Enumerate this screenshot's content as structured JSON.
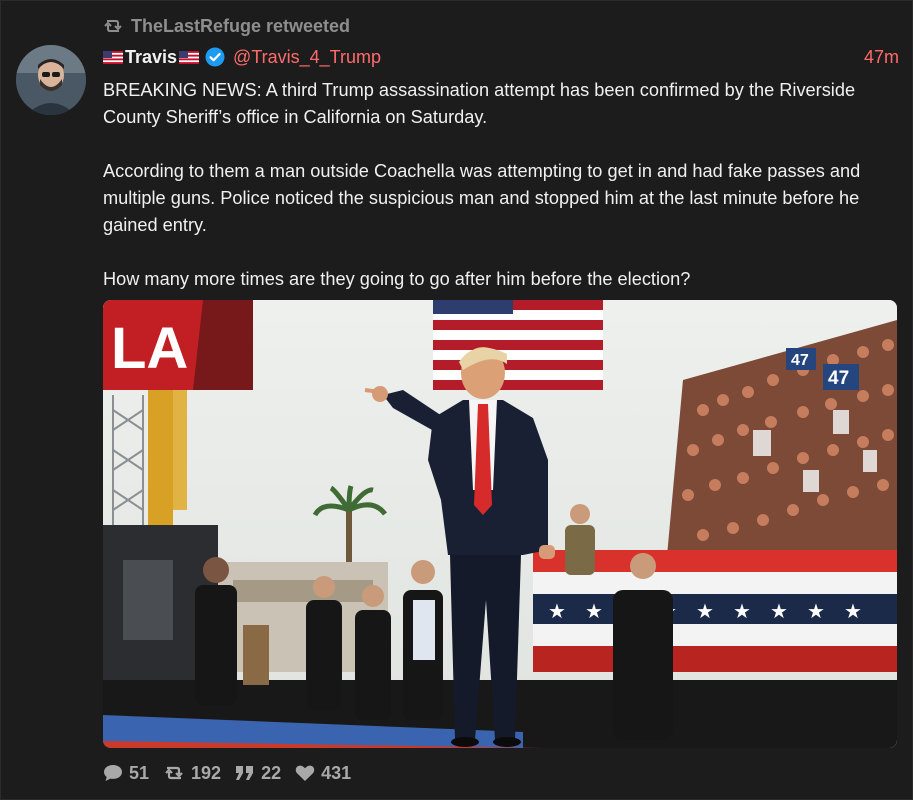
{
  "retweet": {
    "icon": "retweet-icon",
    "text": "TheLastRefuge retweeted"
  },
  "author": {
    "name": "Travis",
    "handle": "@Travis_4_Trump",
    "time": "47m",
    "verified_icon": "verified-badge-icon",
    "flag_icon": "us-flag-icon"
  },
  "post": {
    "paragraphs": [
      "BREAKING NEWS:  A third Trump assassination attempt has been confirmed by the Riverside County Sheriff’s office in California on Saturday.",
      "According to them a man outside Coachella was attempting to get in and had fake passes and multiple guns.  Police noticed the suspicious man and stopped him at the last minute before he gained entry.",
      "How many more times are they going to go after him before the election?"
    ]
  },
  "media": {
    "crowd_signs": [
      "47",
      "47"
    ],
    "banner_text": "LA"
  },
  "actions": {
    "replies": "51",
    "retweets": "192",
    "quotes": "22",
    "likes": "431"
  },
  "colors": {
    "background": "#1c1c1c",
    "accent": "#ff6b6b",
    "muted": "#8e8e8e",
    "verified": "#1d9bf0"
  }
}
